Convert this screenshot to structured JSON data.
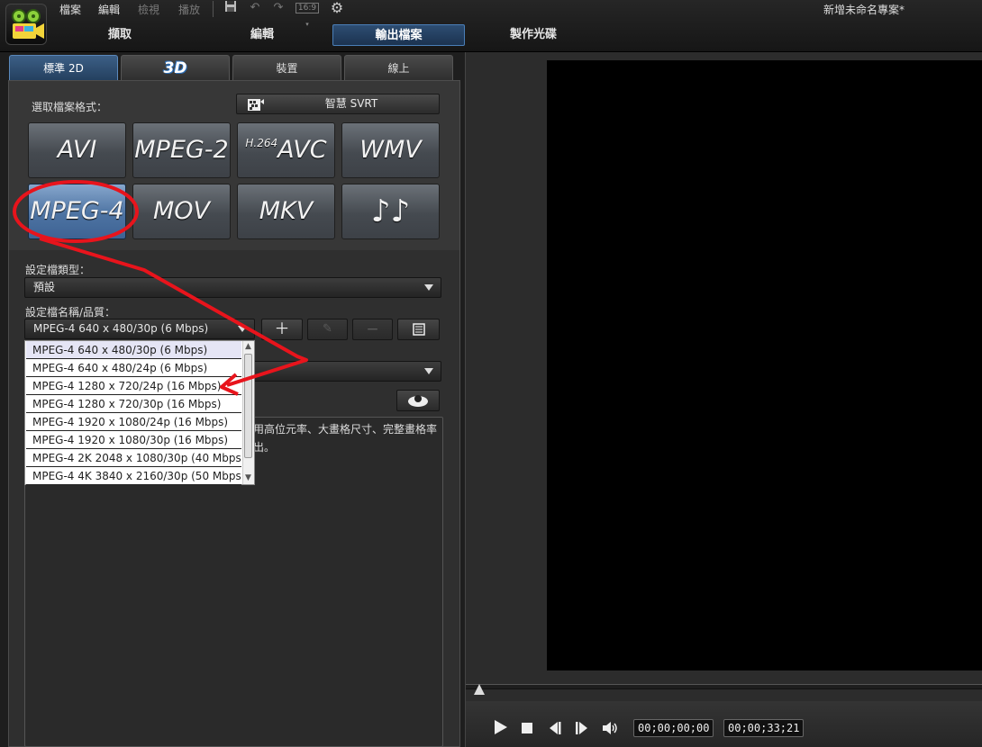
{
  "menu": {
    "file": "檔案",
    "edit": "編輯",
    "view": "檢視",
    "play": "播放"
  },
  "toolbar": {
    "aspect_ratio": "16:9"
  },
  "project_title": "新增未命名專案*",
  "mode_tabs": {
    "capture": "擷取",
    "edit": "編輯",
    "output": "輸出檔案",
    "create_disc": "製作光碟"
  },
  "sub_tabs": {
    "standard_2d": "標準 2D",
    "three_d": "3D",
    "device": "裝置",
    "online": "線上"
  },
  "format_section": {
    "label": "選取檔案格式：",
    "svrt_button": "智慧 SVRT"
  },
  "formats": [
    {
      "label": "AVI"
    },
    {
      "label": "MPEG-2"
    },
    {
      "label_prefix": "H.264",
      "label": "AVC"
    },
    {
      "label": "WMV"
    },
    {
      "label": "MPEG-4"
    },
    {
      "label": "MOV"
    },
    {
      "label": "MKV"
    },
    {
      "label": "♪♪"
    }
  ],
  "selected_format": "MPEG-4",
  "profile_type": {
    "label": "設定檔類型：",
    "value": "預設"
  },
  "profile_name": {
    "label": "設定檔名稱/品質：",
    "value": "MPEG-4 640 x 480/30p (6 Mbps)"
  },
  "quality_options": [
    "MPEG-4 640 x 480/30p (6 Mbps)",
    "MPEG-4 640 x 480/24p (6 Mbps)",
    "MPEG-4 1280 x 720/24p (16 Mbps)",
    "MPEG-4 1280 x 720/30p (16 Mbps)",
    "MPEG-4 1920 x 1080/24p (16 Mbps)",
    "MPEG-4 1920 x 1080/30p (16 Mbps)",
    "MPEG-4 2K 2048 x 1080/30p (40 Mbps)",
    "MPEG-4 4K 3840 x 2160/30p (50 Mbps)"
  ],
  "description": {
    "line1": "用高位元率、大畫格尺寸、完整畫格率",
    "line2": "出。"
  },
  "player": {
    "current_time": "00;00;00;00",
    "total_time": "00;00;33;21"
  },
  "colors": {
    "accent": "#4a7fb8",
    "annotation": "#e8141c"
  }
}
